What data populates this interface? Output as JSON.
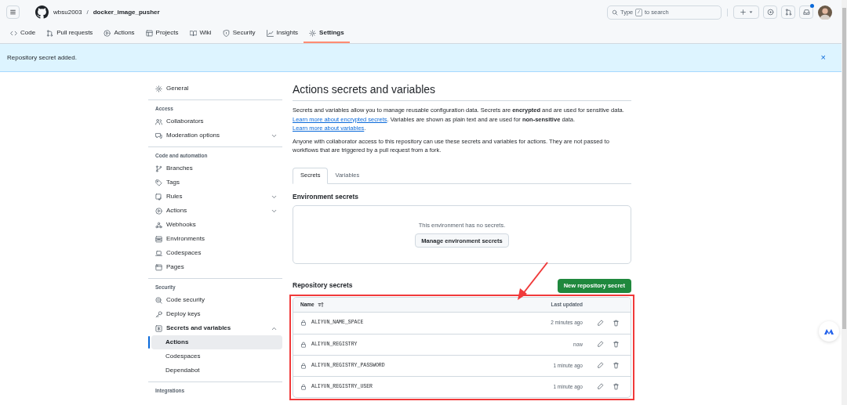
{
  "header": {
    "owner": "wbsu2003",
    "separator": "/",
    "repo": "docker_image_pusher",
    "search": {
      "prefix": "Type",
      "key": "/",
      "suffix": "to search"
    },
    "has_unread": true
  },
  "repo_tabs": [
    {
      "label": "Code",
      "selected": false
    },
    {
      "label": "Pull requests",
      "selected": false
    },
    {
      "label": "Actions",
      "selected": false
    },
    {
      "label": "Projects",
      "selected": false
    },
    {
      "label": "Wiki",
      "selected": false
    },
    {
      "label": "Security",
      "selected": false
    },
    {
      "label": "Insights",
      "selected": false
    },
    {
      "label": "Settings",
      "selected": true
    }
  ],
  "flash": {
    "message": "Repository secret added.",
    "close": "×"
  },
  "sidebar": {
    "sections": [
      {
        "items": [
          {
            "label": "General",
            "selected": false
          }
        ]
      },
      {
        "heading": "Access",
        "items": [
          {
            "label": "Collaborators",
            "selected": false
          },
          {
            "label": "Moderation options",
            "selected": false,
            "expanded": false
          }
        ]
      },
      {
        "heading": "Code and automation",
        "items": [
          {
            "label": "Branches",
            "selected": false
          },
          {
            "label": "Tags",
            "selected": false
          },
          {
            "label": "Rules",
            "selected": false,
            "expanded": false
          },
          {
            "label": "Actions",
            "selected": false,
            "expanded": false
          },
          {
            "label": "Webhooks",
            "selected": false
          },
          {
            "label": "Environments",
            "selected": false
          },
          {
            "label": "Codespaces",
            "selected": false
          },
          {
            "label": "Pages",
            "selected": false
          }
        ]
      },
      {
        "heading": "Security",
        "items": [
          {
            "label": "Code security",
            "selected": false
          },
          {
            "label": "Deploy keys",
            "selected": false
          },
          {
            "label": "Secrets and variables",
            "selected": false,
            "expanded": true,
            "children": [
              {
                "label": "Actions",
                "selected": true
              },
              {
                "label": "Codespaces",
                "selected": false
              },
              {
                "label": "Dependabot",
                "selected": false
              }
            ]
          }
        ]
      },
      {
        "heading": "Integrations"
      }
    ]
  },
  "main": {
    "title": "Actions secrets and variables",
    "paragraphs": [
      [
        {
          "text": "Secrets and variables allow you to manage reusable configuration data. Secrets are **encrypted** and are used for sensitive data. "
        },
        {
          "link": "Learn more about encrypted secrets"
        },
        {
          "text": ". Variables are shown as plain text and are used for **non-sensitive** data. "
        },
        {
          "link": "Learn more about variables"
        },
        {
          "text": "."
        }
      ],
      [
        {
          "text": "Anyone with collaborator access to this repository can use these secrets and variables for actions. They are not passed to workflows that are triggered by a pull request from a fork."
        }
      ]
    ],
    "tabs": [
      {
        "label": "Secrets",
        "selected": true
      },
      {
        "label": "Variables",
        "selected": false
      }
    ],
    "environment_secrets": {
      "heading": "Environment secrets",
      "empty_message": "This environment has no secrets.",
      "button": "Manage environment secrets"
    },
    "repository_secrets": {
      "heading": "Repository secrets",
      "button": "New repository secret",
      "columns": [
        "Name",
        "Last updated"
      ],
      "rows": [
        {
          "name": "ALIYUN_NAME_SPACE",
          "updated": "2 minutes ago"
        },
        {
          "name": "ALIYUN_REGISTRY",
          "updated": "now"
        },
        {
          "name": "ALIYUN_REGISTRY_PASSWORD",
          "updated": "1 minute ago"
        },
        {
          "name": "ALIYUN_REGISTRY_USER",
          "updated": "1 minute ago"
        }
      ]
    }
  }
}
